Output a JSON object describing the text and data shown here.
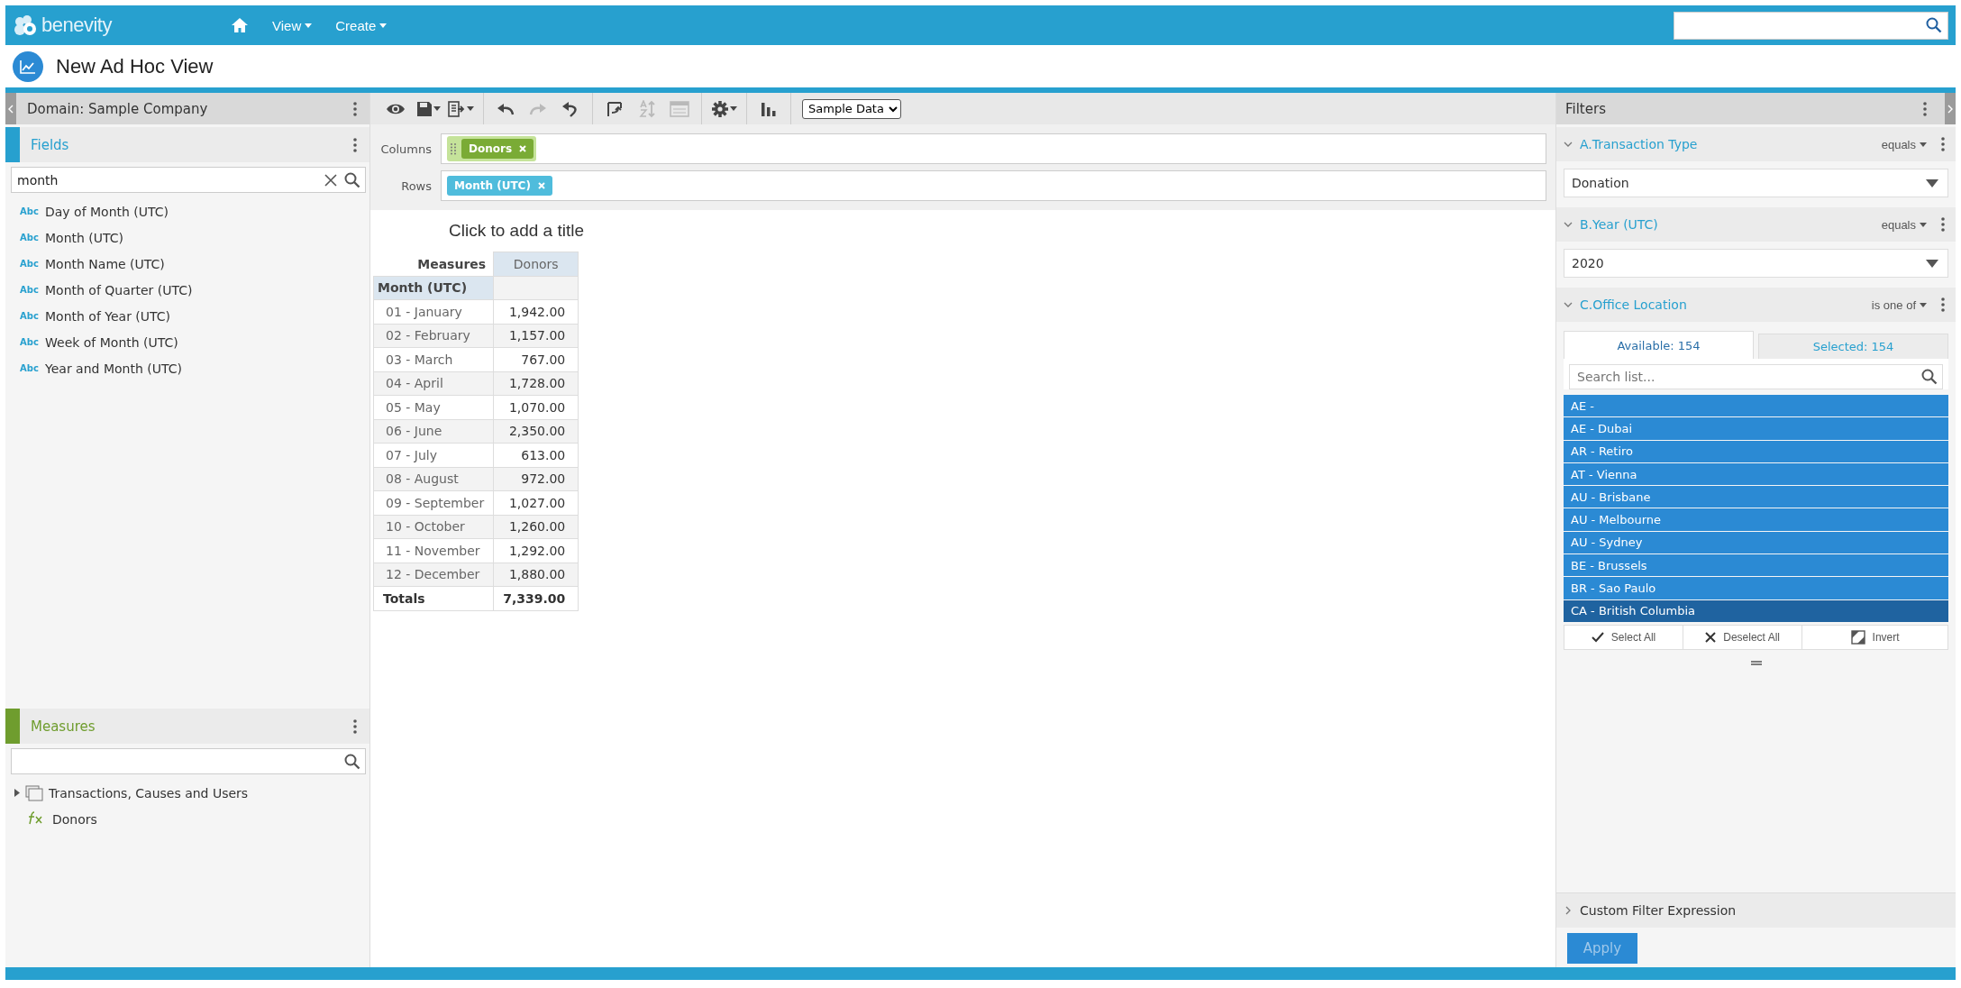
{
  "header": {
    "logo_text": "benevity",
    "nav": [
      {
        "label": "View"
      },
      {
        "label": "Create"
      }
    ]
  },
  "page_title": "New Ad Hoc View",
  "left_panel": {
    "domain": "Domain: Sample Company",
    "fields": {
      "title": "Fields",
      "search_value": "month",
      "items": [
        {
          "type_tag": "Abc",
          "label": "Day of Month (UTC)"
        },
        {
          "type_tag": "Abc",
          "label": "Month (UTC)"
        },
        {
          "type_tag": "Abc",
          "label": "Month Name (UTC)"
        },
        {
          "type_tag": "Abc",
          "label": "Month of Quarter (UTC)"
        },
        {
          "type_tag": "Abc",
          "label": "Month of Year (UTC)"
        },
        {
          "type_tag": "Abc",
          "label": "Week of Month (UTC)"
        },
        {
          "type_tag": "Abc",
          "label": "Year and Month (UTC)"
        }
      ]
    },
    "measures": {
      "title": "Measures",
      "items": [
        {
          "kind": "folder",
          "label": "Transactions, Causes and Users",
          "expanded": false
        },
        {
          "kind": "formula",
          "label": "Donors"
        }
      ]
    }
  },
  "toolbar": {
    "groups": [
      {
        "tools": [
          {
            "kind": "eye",
            "disabled": false,
            "menu": false
          },
          {
            "kind": "save",
            "disabled": false,
            "menu": true
          },
          {
            "kind": "export",
            "disabled": false,
            "menu": true
          }
        ]
      },
      {
        "tools": [
          {
            "kind": "undo",
            "disabled": false,
            "menu": false
          },
          {
            "kind": "redo",
            "disabled": true,
            "menu": false
          },
          {
            "kind": "undo-all",
            "disabled": false,
            "menu": false
          }
        ]
      },
      {
        "tools": [
          {
            "kind": "pivot",
            "disabled": false,
            "menu": false
          },
          {
            "kind": "sort",
            "disabled": true,
            "menu": false
          },
          {
            "kind": "layout",
            "disabled": true,
            "menu": false
          }
        ]
      },
      {
        "tools": [
          {
            "kind": "gear",
            "disabled": false,
            "menu": true
          }
        ]
      },
      {
        "tools": [
          {
            "kind": "chart",
            "disabled": false,
            "menu": false
          }
        ]
      }
    ],
    "data_source": "Sample Data"
  },
  "pivot": {
    "columns_label": "Columns",
    "columns": [
      {
        "label": "Donors",
        "kind": "measure"
      }
    ],
    "rows_label": "Rows",
    "rows": [
      {
        "label": "Month (UTC)",
        "kind": "field"
      }
    ]
  },
  "report": {
    "title": "Click to add a title",
    "table": {
      "measures_label": "Measures",
      "measure_columns": [
        "Donors"
      ],
      "row_header": "Month (UTC)",
      "rows": [
        {
          "label": "01 - January",
          "value": "1,942.00"
        },
        {
          "label": "02 - February",
          "value": "1,157.00"
        },
        {
          "label": "03 - March",
          "value": "767.00"
        },
        {
          "label": "04 - April",
          "value": "1,728.00"
        },
        {
          "label": "05 - May",
          "value": "1,070.00"
        },
        {
          "label": "06 - June",
          "value": "2,350.00"
        },
        {
          "label": "07 - July",
          "value": "613.00"
        },
        {
          "label": "08 - August",
          "value": "972.00"
        },
        {
          "label": "09 - September",
          "value": "1,027.00"
        },
        {
          "label": "10 - October",
          "value": "1,260.00"
        },
        {
          "label": "11 - November",
          "value": "1,292.00"
        },
        {
          "label": "12 - December",
          "value": "1,880.00"
        }
      ],
      "totals": {
        "label": "Totals",
        "value": "7,339.00"
      }
    }
  },
  "filters": {
    "title": "Filters",
    "items": [
      {
        "kind": "single",
        "name": "A.Transaction Type",
        "operator": "equals",
        "expanded": true,
        "value": "Donation"
      },
      {
        "kind": "single",
        "name": "B.Year (UTC)",
        "operator": "equals",
        "expanded": true,
        "value": "2020"
      },
      {
        "kind": "multi",
        "name": "C.Office Location",
        "operator": "is one of",
        "expanded": true,
        "tabs": [
          {
            "label": "Available: 154",
            "selected": true
          },
          {
            "label": "Selected: 154",
            "selected": false
          }
        ],
        "search_placeholder": "Search list...",
        "options": [
          {
            "label": "AE -",
            "selected": true,
            "active": false
          },
          {
            "label": "AE - Dubai",
            "selected": true,
            "active": false
          },
          {
            "label": "AR - Retiro",
            "selected": true,
            "active": false
          },
          {
            "label": "AT - Vienna",
            "selected": true,
            "active": false
          },
          {
            "label": "AU - Brisbane",
            "selected": true,
            "active": false
          },
          {
            "label": "AU - Melbourne",
            "selected": true,
            "active": false
          },
          {
            "label": "AU - Sydney",
            "selected": true,
            "active": false
          },
          {
            "label": "BE - Brussels",
            "selected": true,
            "active": false
          },
          {
            "label": "BR - Sao Paulo",
            "selected": true,
            "active": false
          },
          {
            "label": "CA - British Columbia",
            "selected": true,
            "active": true
          }
        ],
        "actions": [
          {
            "kind": "check",
            "label": "Select All"
          },
          {
            "kind": "cross",
            "label": "Deselect All"
          },
          {
            "kind": "invert",
            "label": "Invert"
          }
        ]
      }
    ],
    "custom_expression": {
      "label": "Custom Filter Expression",
      "expanded": false
    },
    "apply": {
      "label": "Apply",
      "disabled": true
    }
  }
}
